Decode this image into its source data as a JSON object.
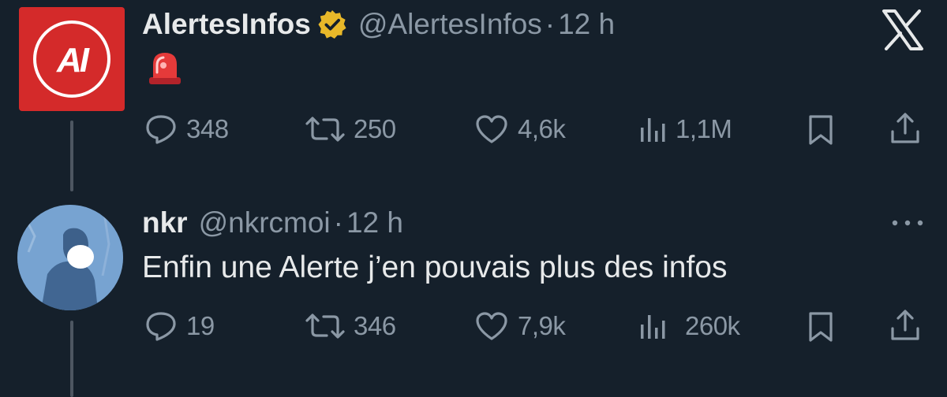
{
  "app": {
    "brand_icon": "x-logo-icon"
  },
  "tweets": [
    {
      "author": {
        "name": "AlertesInfos",
        "handle": "@AlertesInfos",
        "verified_badge": "gold-verified-icon",
        "avatar_text": "AI",
        "avatar_color": "#d42a2a"
      },
      "separator": "·",
      "time": "12 h",
      "content": "🚨",
      "actions": {
        "replies": "348",
        "retweets": "250",
        "likes": "4,6k",
        "views": "1,1M"
      }
    },
    {
      "author": {
        "name": "nkr",
        "handle": "@nkrcmoi",
        "avatar_color": "#6f9ccc"
      },
      "separator": "·",
      "time": "12 h",
      "content": "Enfin une Alerte j’en pouvais plus des infos",
      "more_icon": "more-horizontal-icon",
      "actions": {
        "replies": "19",
        "retweets": "346",
        "likes": "7,9k",
        "views": "260k"
      }
    }
  ],
  "colors": {
    "background": "#15202b",
    "text_primary": "#e7e9ea",
    "text_secondary": "#8b98a5",
    "verified_gold": "#e8b829",
    "thread_line": "#4d5661"
  }
}
